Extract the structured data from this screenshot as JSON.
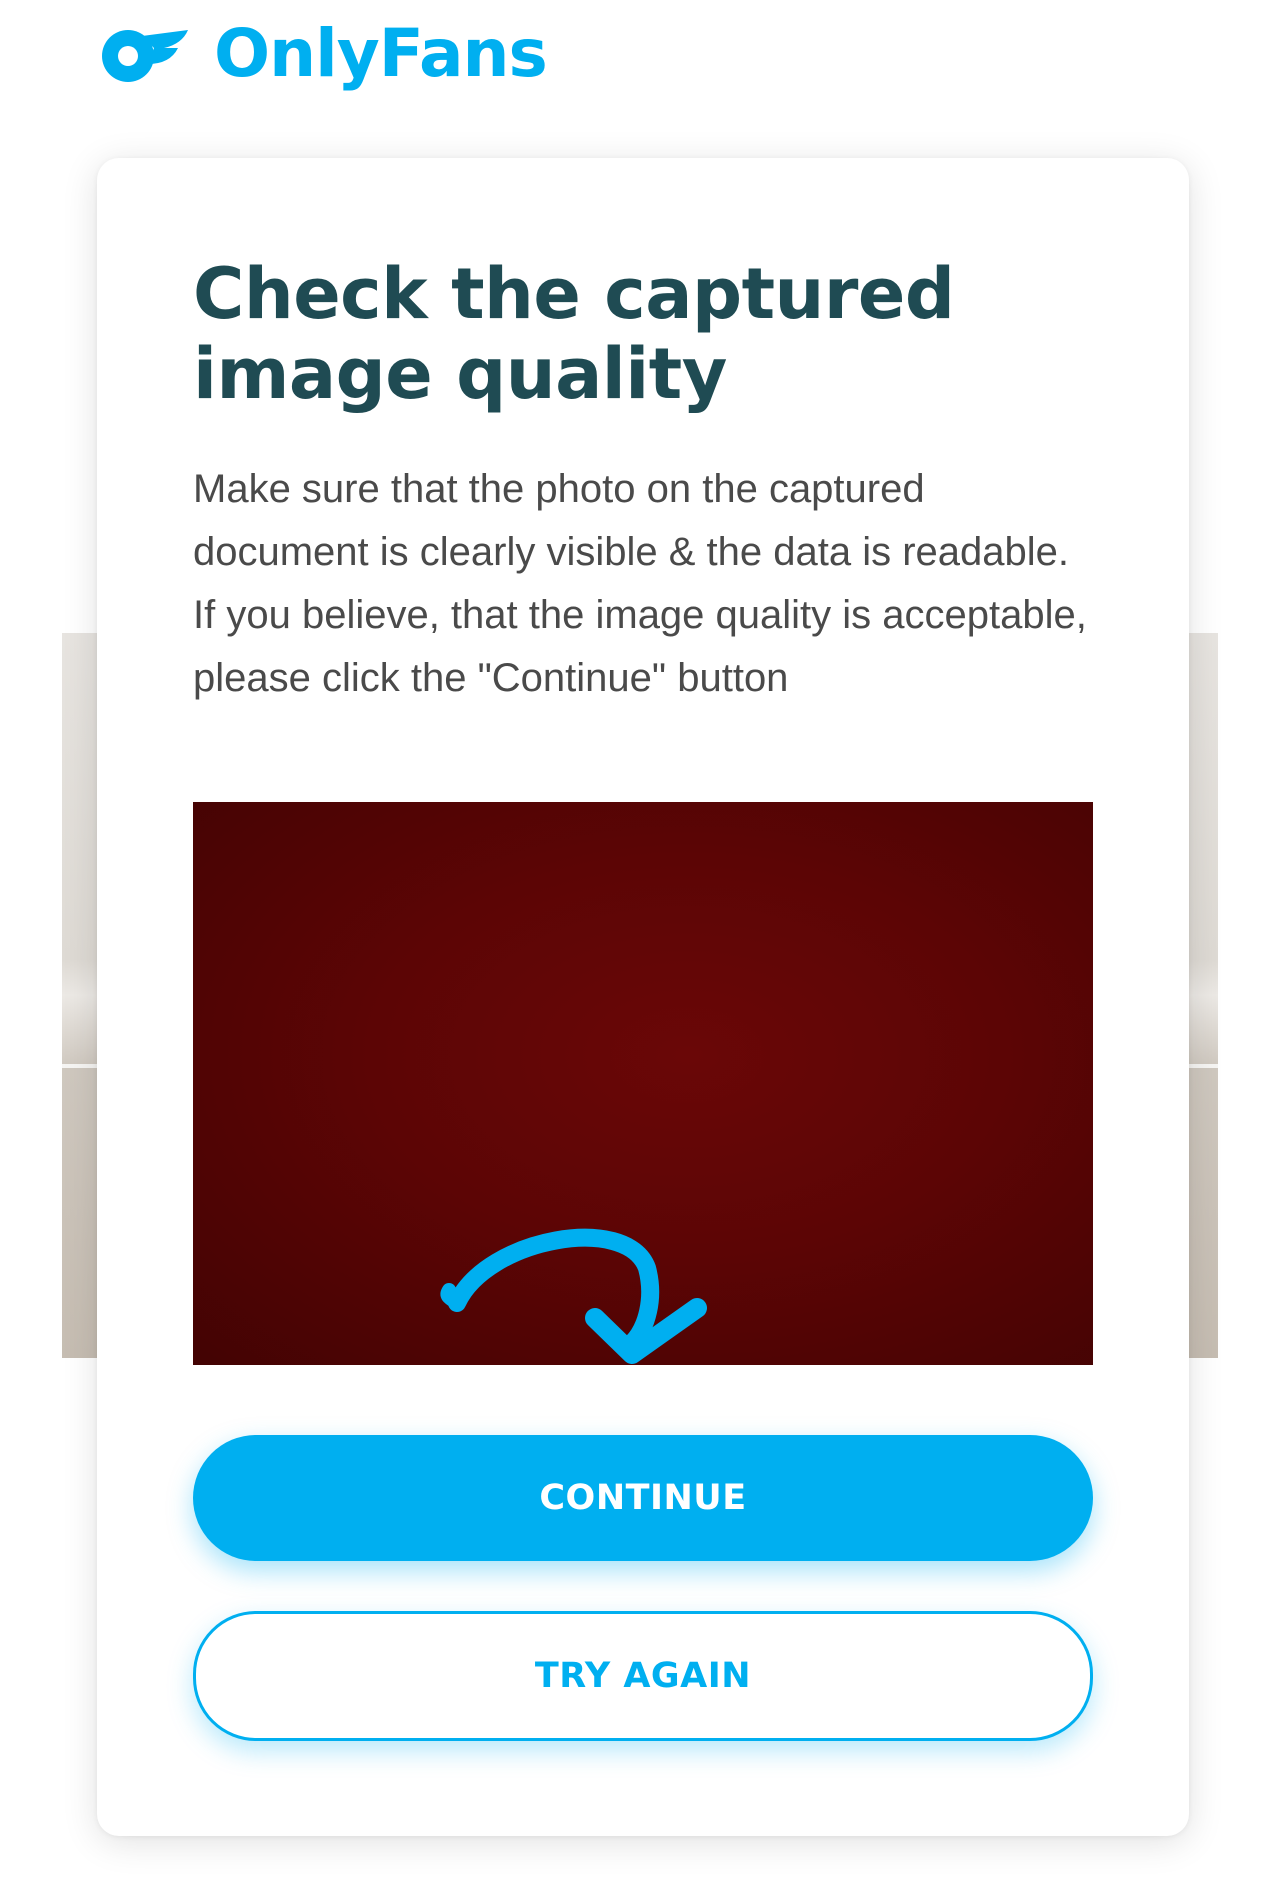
{
  "header": {
    "logo_icon": "onlyfans-logo-icon",
    "brand_name": "OnlyFans"
  },
  "card": {
    "title": "Check the captured image quality",
    "description": "Make sure that the photo on the captured document is clearly visible & the data is readable. If you believe, that the image quality is acceptable, please click the \"Continue\" button",
    "image_alt": "captured document image",
    "arrow_icon": "curved-arrow-icon",
    "continue_label": "CONTINUE",
    "try_again_label": "TRY AGAIN"
  },
  "colors": {
    "brand": "#00aff0",
    "title": "#1f4b53",
    "text": "#4a4a4a",
    "document": "#5c0505"
  }
}
